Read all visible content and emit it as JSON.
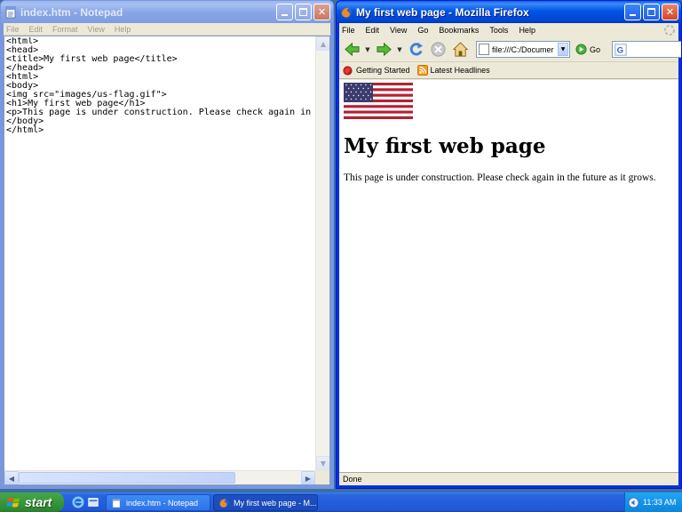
{
  "notepad": {
    "title": "index.htm - Notepad",
    "menu": [
      "File",
      "Edit",
      "Format",
      "View",
      "Help"
    ],
    "lines": [
      "<html>",
      "<head>",
      "<title>My first web page</title>",
      "</head>",
      "<html>",
      "<body>",
      "<img src=\"images/us-flag.gif\">",
      "<h1>My first web page</h1>",
      "<p>This page is under construction. Please check again in t",
      "</body>",
      "</html>"
    ]
  },
  "firefox": {
    "title": "My first web page - Mozilla Firefox",
    "menu": [
      "File",
      "Edit",
      "View",
      "Go",
      "Bookmarks",
      "Tools",
      "Help"
    ],
    "url": "file:///C:/Documer",
    "go_label": "Go",
    "bookmarks": [
      "Getting Started",
      "Latest Headlines"
    ],
    "page": {
      "heading": "My first web page",
      "paragraph": "This page is under construction. Please check again in the future as it grows."
    },
    "status": "Done"
  },
  "taskbar": {
    "start_label": "start",
    "buttons": [
      "index.htm - Notepad",
      "My first web page - M..."
    ],
    "clock": "11:33 AM"
  },
  "colors": {
    "title_active": "#0055e5",
    "title_inactive": "#7e9de0",
    "taskbar": "#245edc",
    "start": "#3b9a3d",
    "flag_red": "#b22234",
    "flag_blue": "#3c3b6e"
  }
}
